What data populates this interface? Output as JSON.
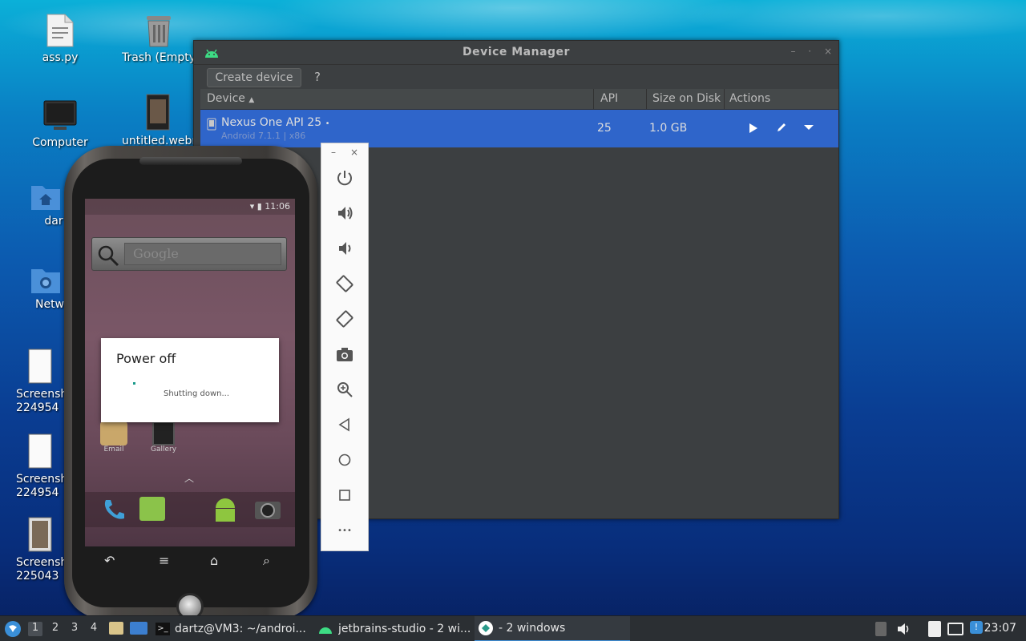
{
  "desktop": {
    "icons": [
      {
        "label": "ass.py"
      },
      {
        "label": "Trash (Empty)"
      },
      {
        "label": "Computer"
      },
      {
        "label": "untitled.webm"
      },
      {
        "label": "dar"
      },
      {
        "label": "Netw"
      },
      {
        "label": "Screensh\n224954"
      },
      {
        "label": "Screensh\n224954"
      },
      {
        "label": "Screensh\n225043"
      }
    ]
  },
  "device_manager": {
    "title": "Device Manager",
    "create_device_label": "Create device",
    "help_label": "?",
    "columns": {
      "device": "Device",
      "api": "API",
      "size": "Size on Disk",
      "actions": "Actions"
    },
    "rows": [
      {
        "name": "Nexus One API 25",
        "subtitle": "Android 7.1.1 | x86",
        "api": "25",
        "size": "1.0 GB"
      }
    ]
  },
  "emulator": {
    "status_time": "11:06",
    "search_placeholder": "Google",
    "apps": [
      {
        "label": "Email"
      },
      {
        "label": "Gallery"
      }
    ],
    "dialog": {
      "title": "Power off",
      "message": "Shutting down..."
    },
    "toolbar": {
      "minimize_label": "–",
      "close_label": "×",
      "more_label": "•••"
    }
  },
  "taskbar": {
    "workspaces": [
      "1",
      "2",
      "3",
      "4"
    ],
    "active_workspace": "1",
    "tasks": [
      {
        "label": "dartz@VM3: ~/androi..."
      },
      {
        "label": "jetbrains-studio - 2 wi..."
      },
      {
        "label": "- 2 windows"
      }
    ],
    "clock": "23:07"
  },
  "colors": {
    "selection": "#2f65ca",
    "android_green": "#3ddc84",
    "taskbar_bg": "#2b2f33"
  }
}
